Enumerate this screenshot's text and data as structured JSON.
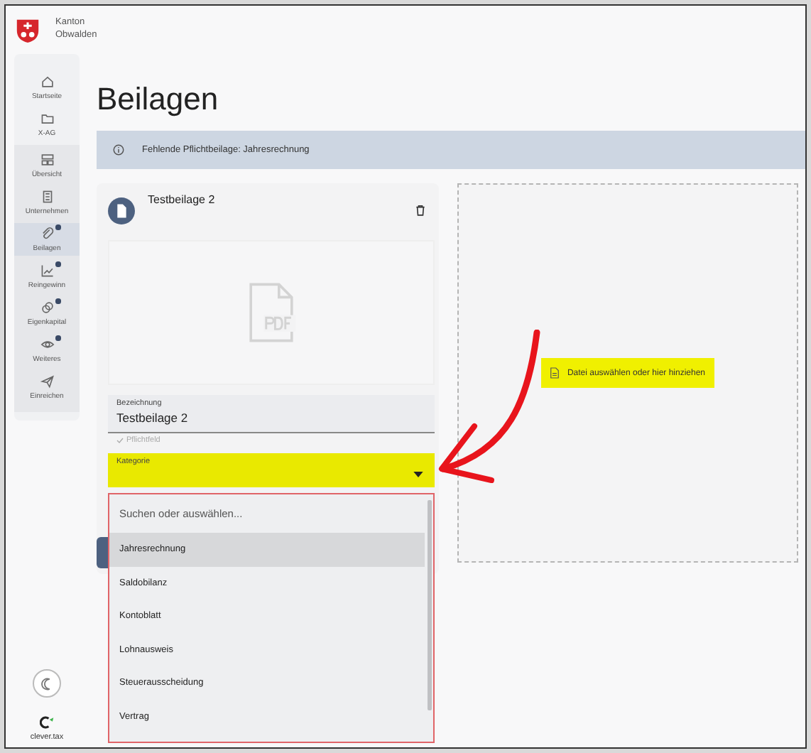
{
  "header": {
    "name_lines": [
      "Kanton",
      "Obwalden"
    ]
  },
  "sidebar": {
    "top_items": [
      {
        "label": "Startseite",
        "dot": false,
        "selected": false
      },
      {
        "label": "X-AG",
        "dot": false,
        "selected": false
      }
    ],
    "group_items": [
      {
        "label": "Übersicht",
        "dot": false,
        "selected": false
      },
      {
        "label": "Unternehmen",
        "dot": false,
        "selected": false
      },
      {
        "label": "Beilagen",
        "dot": true,
        "selected": true
      },
      {
        "label": "Reingewinn",
        "dot": true,
        "selected": false
      },
      {
        "label": "Eigenkapital",
        "dot": true,
        "selected": false
      },
      {
        "label": "Weiteres",
        "dot": true,
        "selected": false
      },
      {
        "label": "Einreichen",
        "dot": false,
        "selected": false
      }
    ],
    "brand": "clever.tax"
  },
  "page_title": "Beilagen",
  "banner": {
    "text": "Fehlende Pflichtbeilage: Jahresrechnung"
  },
  "attachment_card": {
    "title": "Testbeilage 2",
    "name_field": {
      "label": "Bezeichnung",
      "value": "Testbeilage 2",
      "hint": "Pflichtfeld"
    },
    "category_field": {
      "label": "Kategorie",
      "expanded": true,
      "highlighted": true
    },
    "dropdown": {
      "placeholder": "Suchen oder auswählen...",
      "options": [
        {
          "label": "Jahresrechnung",
          "selected": true
        },
        {
          "label": "Saldobilanz",
          "selected": false
        },
        {
          "label": "Kontoblatt",
          "selected": false
        },
        {
          "label": "Lohnausweis",
          "selected": false
        },
        {
          "label": "Steuerausscheidung",
          "selected": false
        },
        {
          "label": "Vertrag",
          "selected": false
        }
      ]
    }
  },
  "dropzone": {
    "text": "Datei auswählen oder hier hinziehen",
    "highlighted": true
  }
}
